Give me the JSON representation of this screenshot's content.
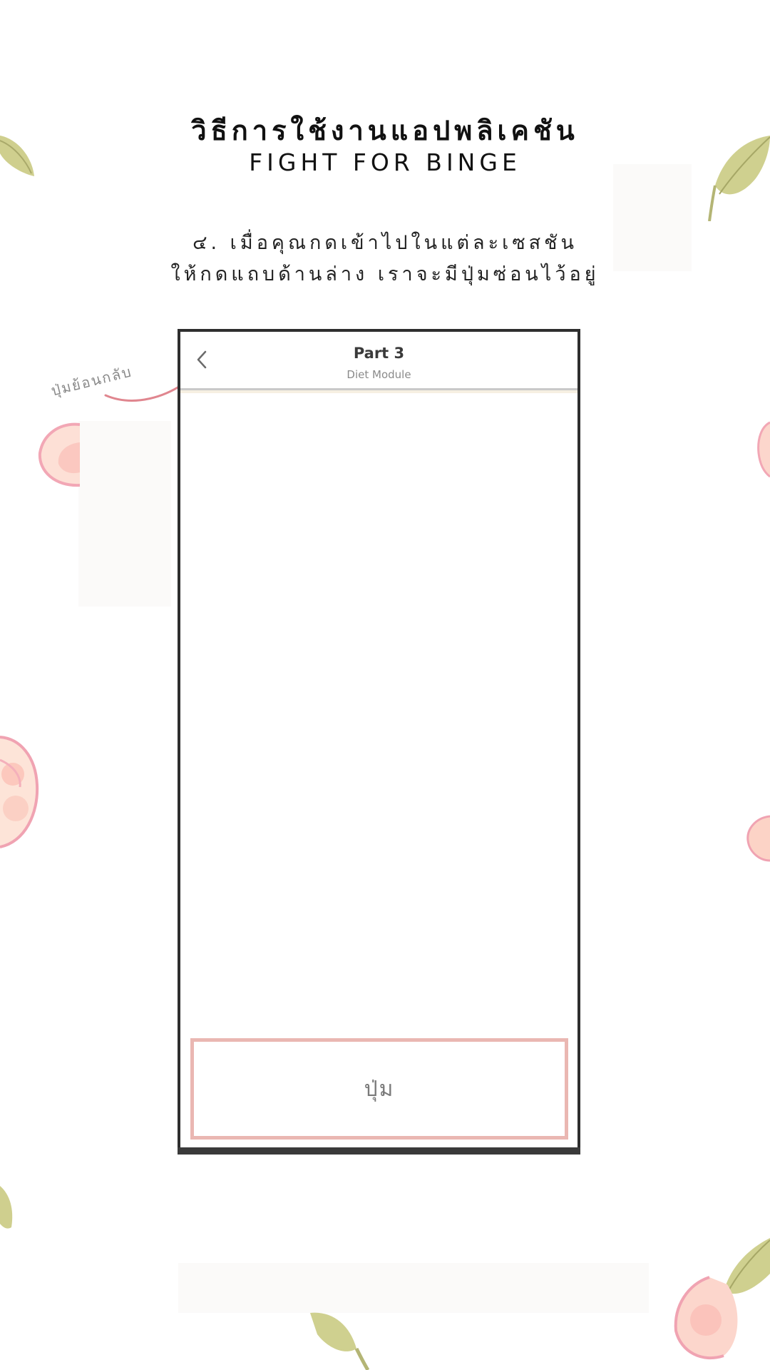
{
  "heading": {
    "title_th": "วิธีการใช้งานแอปพลิเคชัน",
    "title_en": "FIGHT FOR BINGE"
  },
  "instructions": {
    "line1": "๔. เมื่อคุณกดเข้าไปในแต่ละเซสชัน",
    "line2": "ให้กดแถบด้านล่าง เราจะมีปุ่มซ่อนไว้อยู่"
  },
  "annotation": {
    "label": "ปุ่มย้อนกลับ",
    "arrow_color": "#e0868f"
  },
  "phone": {
    "header": {
      "back_icon": "chevron-left-icon",
      "title": "Part 3",
      "subtitle": "Diet Module"
    },
    "hidden_button": {
      "label": "ปุ่ม",
      "border_color": "#eab7b2"
    }
  },
  "colors": {
    "frame": "#2e2e2e",
    "flower_pink": "#f2a7b5",
    "leaf_green": "#c9c98a"
  }
}
